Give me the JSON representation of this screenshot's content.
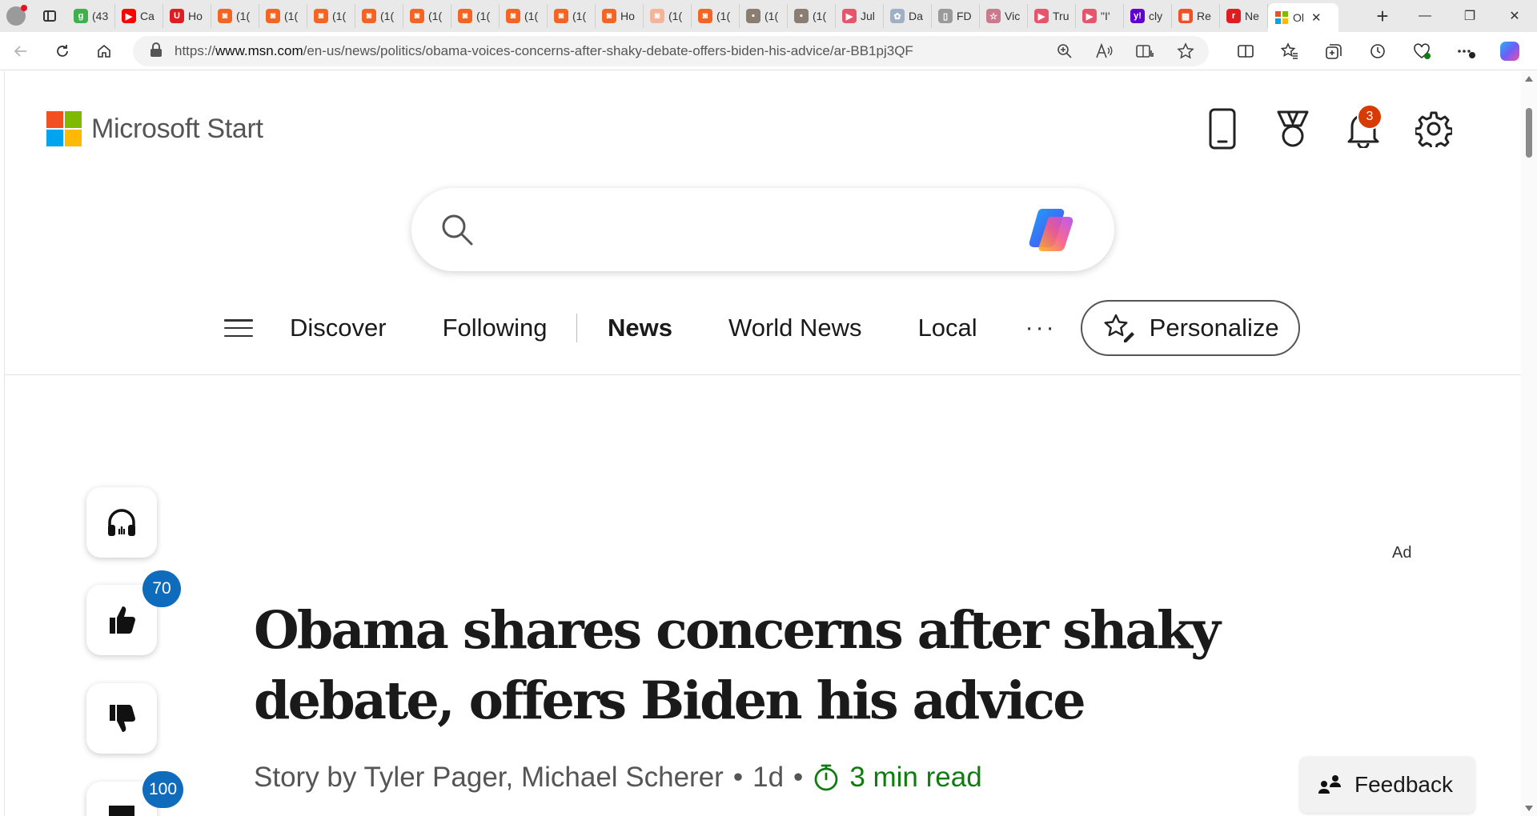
{
  "browser": {
    "tabs": [
      {
        "title": "(43",
        "color": "#3fb04d",
        "glyph": "g"
      },
      {
        "title": "Ca",
        "color": "#ff0000",
        "glyph": "▶"
      },
      {
        "title": "Ho",
        "color": "#e01c23",
        "glyph": "U"
      },
      {
        "title": "(1(",
        "color": "#f26522",
        "glyph": "◙"
      },
      {
        "title": "(1(",
        "color": "#f26522",
        "glyph": "◙"
      },
      {
        "title": "(1(",
        "color": "#f26522",
        "glyph": "◙"
      },
      {
        "title": "(1(",
        "color": "#f26522",
        "glyph": "◙"
      },
      {
        "title": "(1(",
        "color": "#f26522",
        "glyph": "◙"
      },
      {
        "title": "(1(",
        "color": "#f26522",
        "glyph": "◙"
      },
      {
        "title": "(1(",
        "color": "#f26522",
        "glyph": "◙"
      },
      {
        "title": "(1(",
        "color": "#f26522",
        "glyph": "◙"
      },
      {
        "title": "Ho",
        "color": "#f26522",
        "glyph": "◙"
      },
      {
        "title": "(1(",
        "color": "#f4b49a",
        "glyph": "◙"
      },
      {
        "title": "(1(",
        "color": "#f26522",
        "glyph": "◙"
      },
      {
        "title": "(1(",
        "color": "#8a7d72",
        "glyph": "▪"
      },
      {
        "title": "(1(",
        "color": "#8a7d72",
        "glyph": "▪"
      },
      {
        "title": "Jul",
        "color": "#e6556b",
        "glyph": "▶"
      },
      {
        "title": "Da",
        "color": "#9fb0c4",
        "glyph": "✿"
      },
      {
        "title": "FD",
        "color": "#9a9a9a",
        "glyph": "▯"
      },
      {
        "title": "Vic",
        "color": "#c97a8e",
        "glyph": "☆"
      },
      {
        "title": "Tru",
        "color": "#e6556b",
        "glyph": "▶"
      },
      {
        "title": "\"I'",
        "color": "#e6556b",
        "glyph": "▶"
      },
      {
        "title": "cly",
        "color": "#6001d2",
        "glyph": "y!"
      },
      {
        "title": "Re",
        "color": "#f25022",
        "glyph": "▦"
      },
      {
        "title": "Ne",
        "color": "#e01c23",
        "glyph": "r"
      }
    ],
    "active_tab": {
      "title": "Ol",
      "close": "✕"
    },
    "new_tab": "+",
    "window": {
      "minimize": "—",
      "restore": "❐",
      "close": "✕"
    },
    "url": {
      "prefix": "https://",
      "host": "www.msn.com",
      "path": "/en-us/news/politics/obama-voices-concerns-after-shaky-debate-offers-biden-his-advice/ar-BB1pj3QF"
    }
  },
  "header": {
    "brand_name": "Microsoft Start",
    "logo_colors": [
      "#f25022",
      "#7fba00",
      "#00a4ef",
      "#ffb900"
    ],
    "notification_count": "3"
  },
  "search": {
    "placeholder": ""
  },
  "nav": {
    "items": [
      "Discover",
      "Following",
      "News",
      "World News",
      "Local"
    ],
    "active": "News",
    "more": "···",
    "personalize_label": "Personalize"
  },
  "rail": {
    "like_count": "70",
    "comment_count": "100"
  },
  "ad_label": "Ad",
  "article": {
    "title": "Obama shares concerns after shaky debate, offers Biden his advice",
    "byline": "Story by Tyler Pager, Michael Scherer",
    "age": "1d",
    "separator": "•",
    "read_time": "3 min read"
  },
  "feedback_label": "Feedback",
  "colors": {
    "accent_blue": "#0f6cbd",
    "notification_red": "#d83b01",
    "read_time_green": "#107c10"
  }
}
